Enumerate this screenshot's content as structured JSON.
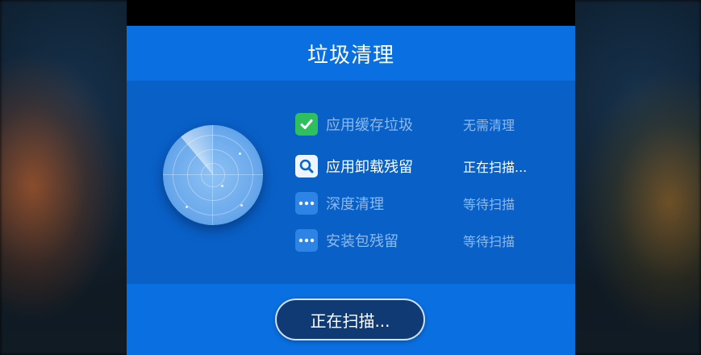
{
  "dialog": {
    "title": "垃圾清理"
  },
  "items": [
    {
      "label": "应用缓存垃圾",
      "status": "无需清理",
      "icon": "check-icon",
      "state": "done"
    },
    {
      "label": "应用卸载残留",
      "status": "正在扫描...",
      "icon": "search-icon",
      "state": "scanning"
    },
    {
      "label": "深度清理",
      "status": "等待扫描",
      "icon": "more-dots-icon",
      "state": "waiting"
    },
    {
      "label": "安装包残留",
      "status": "等待扫描",
      "icon": "more-dots-icon",
      "state": "waiting"
    }
  ],
  "action": {
    "button_label": "正在扫描..."
  },
  "colors": {
    "dialog_bg": "#0a6fe0",
    "panel_bg": "#0961c8",
    "success": "#2fbf5f",
    "button_bg": "#0f3a73"
  }
}
